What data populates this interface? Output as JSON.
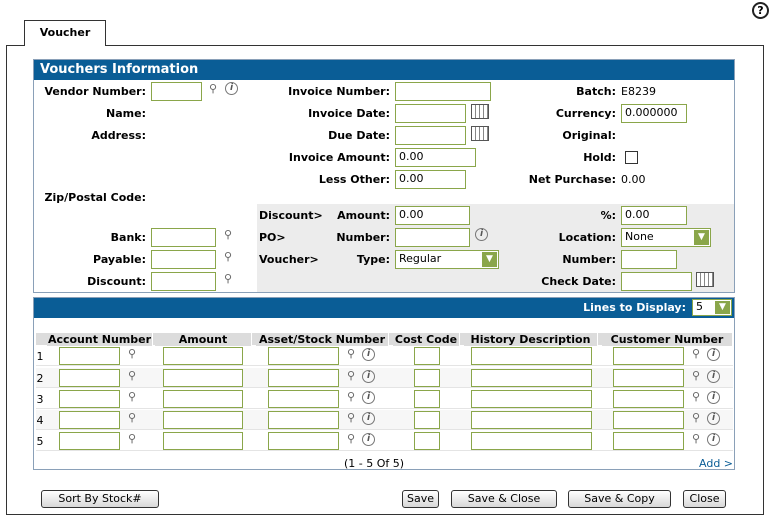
{
  "tab": {
    "label": "Voucher"
  },
  "info_section": {
    "title": "Vouchers Information",
    "vendor_number_label": "Vendor Number:",
    "name_label": "Name:",
    "address_label": "Address:",
    "zip_label": "Zip/Postal Code:",
    "bank_label": "Bank:",
    "payable_label": "Payable:",
    "discount_label": "Discount:",
    "invoice_number_label": "Invoice Number:",
    "invoice_date_label": "Invoice Date:",
    "due_date_label": "Due Date:",
    "invoice_amount_label": "Invoice Amount:",
    "invoice_amount_value": "0.00",
    "less_other_label": "Less Other:",
    "less_other_value": "0.00",
    "batch_label": "Batch:",
    "batch_value": "E8239",
    "currency_label": "Currency:",
    "currency_value": "0.000000",
    "original_label": "Original:",
    "hold_label": "Hold:",
    "net_purchase_label": "Net Purchase:",
    "net_purchase_value": "0.00",
    "discount_group_label": "Discount>",
    "discount_amount_label": "Amount:",
    "discount_amount_value": "0.00",
    "percent_label": "%:",
    "percent_value": "0.00",
    "po_group_label": "PO>",
    "po_number_label": "Number:",
    "location_label": "Location:",
    "location_value": "None",
    "voucher_group_label": "Voucher>",
    "type_label": "Type:",
    "type_value": "Regular",
    "voucher_number_label": "Number:",
    "check_date_label": "Check Date:"
  },
  "lines": {
    "lines_to_display_label": "Lines to Display:",
    "lines_to_display_value": "5",
    "columns": [
      "Account Number",
      "Amount",
      "Asset/Stock Number",
      "Cost Code",
      "History Description",
      "Customer Number"
    ],
    "row_numbers": [
      "1",
      "2",
      "3",
      "4",
      "5"
    ],
    "pager_text": "(1 - 5 Of 5)",
    "add_link": "Add >"
  },
  "buttons": {
    "sort_by_stock": "Sort By Stock#",
    "save": "Save",
    "save_close": "Save & Close",
    "save_copy": "Save & Copy",
    "close": "Close"
  },
  "colors": {
    "header_bg": "#0a5d96",
    "input_border": "#8aa64a"
  }
}
